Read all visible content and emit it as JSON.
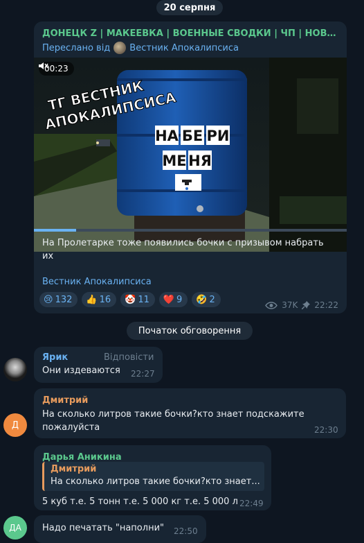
{
  "date_label": "20 серпня",
  "post": {
    "channel_title": "ДОНЕЦК Z | МАКЕЕВКА | ВОЕННЫЕ СВОДКИ | ЧП | НОВОС...",
    "forwarded_prefix": "Переслано від",
    "forwarded_from": "Вестник Апокалипсиса",
    "video_duration": "00:23",
    "video_progress": 0.135,
    "watermark_line1": "ТГ ВЕСТНИК",
    "watermark_line2": "АПОКАЛИПСИСА",
    "barrel_line1": [
      "НА",
      "БЕ",
      "РИ"
    ],
    "barrel_line2": [
      "МЕ",
      "НЯ"
    ],
    "caption": "На Пролетарке тоже появились бочки с призывом набрать их",
    "signature": "Вестник Апокалипсиса",
    "reactions": [
      {
        "emoji": "😢",
        "count": "132"
      },
      {
        "emoji": "👍",
        "count": "16"
      },
      {
        "emoji": "🤡",
        "count": "11"
      },
      {
        "emoji": "❤️",
        "count": "9"
      },
      {
        "emoji": "🤣",
        "count": "2"
      }
    ],
    "views": "37K",
    "time": "22:22",
    "icons": {
      "views": "eye-icon",
      "pin": "pin-icon",
      "mute": "mute-icon"
    }
  },
  "discussion_label": "Початок обговорення",
  "messages": [
    {
      "sender": "Ярик",
      "sender_color": "#6ab2f2",
      "reply_label": "Відповісти",
      "text": "Они издеваются",
      "time": "22:27"
    },
    {
      "sender": "Дмитрий",
      "sender_color": "#e79b5d",
      "avatar_letter": "Д",
      "avatar_color": "#f08a3f",
      "text": "На сколько литров такие бочки?кто знает подскажите пожалуйста",
      "time": "22:30"
    },
    {
      "sender": "Дарья Аникина",
      "sender_color": "#5bc88d",
      "quote_sender": "Дмитрий",
      "quote_text": "На сколько литров такие бочки?кто знает...",
      "text": "5 куб т.е. 5 тонн т.е. 5 000 кг т.е. 5 000 л",
      "time": "22:49"
    },
    {
      "avatar_letter": "ДА",
      "avatar_color": "#5bc88d",
      "text": "Надо печатать \"наполни\"",
      "time": "22:50"
    }
  ],
  "colors": {
    "background": "#0e1621",
    "bubble": "#182533",
    "accent": "#6ab2f2",
    "muted": "#6d7f8f"
  }
}
